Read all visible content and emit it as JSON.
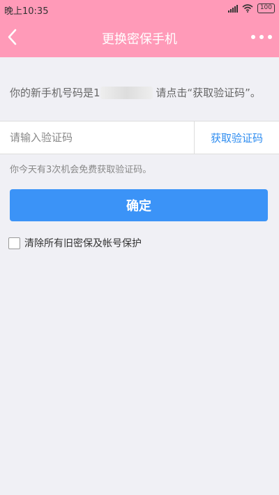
{
  "status_bar": {
    "time": "晚上10:35",
    "battery": "100"
  },
  "nav": {
    "title": "更换密保手机",
    "back_icon": "chevron-left-icon",
    "more_icon": "more-dots-icon"
  },
  "info": {
    "prefix": "你的新手机号码是1",
    "masked": "**********",
    "suffix": " 请点击“获取验证码”。"
  },
  "form": {
    "code_placeholder": "请输入验证码",
    "get_code_label": "获取验证码",
    "hint": "你今天有3次机会免费获取验证码。",
    "confirm_label": "确定",
    "checkbox_label": "清除所有旧密保及帐号保护"
  },
  "colors": {
    "header": "#ff9ab8",
    "accent": "#3b93f7",
    "link": "#2d8cf0"
  }
}
